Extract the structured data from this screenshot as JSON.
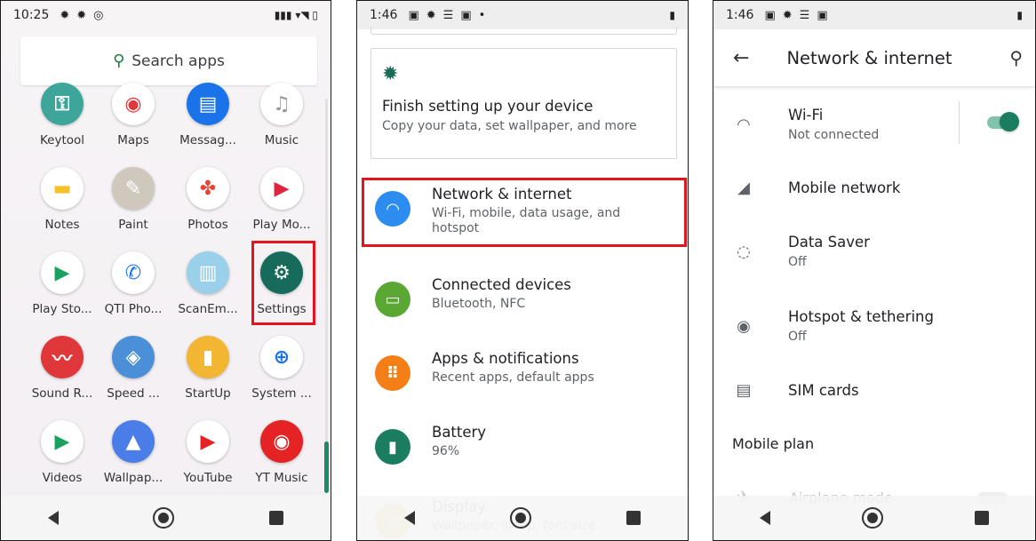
{
  "phone1": {
    "status": {
      "time": "10:25"
    },
    "search": {
      "label": "Search apps"
    },
    "apps": [
      {
        "label": "Keytool",
        "color": "#3da59a",
        "icon": "keytool-icon"
      },
      {
        "label": "Maps",
        "color": "#ffffff",
        "icon": "maps-icon"
      },
      {
        "label": "Messag...",
        "color": "#1a73e8",
        "icon": "messages-icon"
      },
      {
        "label": "Music",
        "color": "#ffffff",
        "icon": "music-icon"
      },
      {
        "label": "Notes",
        "color": "#ffffff",
        "icon": "notes-icon"
      },
      {
        "label": "Paint",
        "color": "#cfc8bd",
        "icon": "paint-icon"
      },
      {
        "label": "Photos",
        "color": "#ffffff",
        "icon": "photos-icon"
      },
      {
        "label": "Play Mo...",
        "color": "#ffffff",
        "icon": "play-movies-icon"
      },
      {
        "label": "Play Sto...",
        "color": "#ffffff",
        "icon": "play-store-icon"
      },
      {
        "label": "QTI Pho...",
        "color": "#ffffff",
        "icon": "phone-icon"
      },
      {
        "label": "ScanEm...",
        "color": "#9bd0ea",
        "icon": "scanem-icon"
      },
      {
        "label": "Settings",
        "color": "#176b5a",
        "icon": "settings-icon"
      },
      {
        "label": "Sound R...",
        "color": "#e0383a",
        "icon": "sound-recorder-icon"
      },
      {
        "label": "Speed ...",
        "color": "#4a8fd8",
        "icon": "speed-icon"
      },
      {
        "label": "StartUp",
        "color": "#f3b632",
        "icon": "startup-icon"
      },
      {
        "label": "System ...",
        "color": "#ffffff",
        "icon": "system-icon"
      },
      {
        "label": "Videos",
        "color": "#ffffff",
        "icon": "videos-icon"
      },
      {
        "label": "Wallpap...",
        "color": "#4b7de8",
        "icon": "wallpaper-icon"
      },
      {
        "label": "YouTube",
        "color": "#ffffff",
        "icon": "youtube-icon"
      },
      {
        "label": "YT Music",
        "color": "#e52224",
        "icon": "yt-music-icon"
      }
    ]
  },
  "phone2": {
    "status": {
      "time": "1:46"
    },
    "card": {
      "title": "Finish setting up your device",
      "subtitle": "Copy your data, set wallpaper, and more"
    },
    "items": [
      {
        "title": "Network & internet",
        "subtitle": "Wi-Fi, mobile, data usage, and hotspot",
        "color": "#2d8cf0",
        "icon": "wifi-icon"
      },
      {
        "title": "Connected devices",
        "subtitle": "Bluetooth, NFC",
        "color": "#5aa733",
        "icon": "connected-devices-icon"
      },
      {
        "title": "Apps & notifications",
        "subtitle": "Recent apps, default apps",
        "color": "#f57f17",
        "icon": "apps-icon"
      },
      {
        "title": "Battery",
        "subtitle": "96%",
        "color": "#1a7d60",
        "icon": "battery-icon"
      },
      {
        "title": "Display",
        "subtitle": "Wallpaper, sleep, font size",
        "color": "#f3b632",
        "icon": "display-icon"
      }
    ]
  },
  "phone3": {
    "status": {
      "time": "1:46"
    },
    "title": "Network & internet",
    "items": [
      {
        "title": "Wi-Fi",
        "subtitle": "Not connected",
        "icon": "wifi-icon"
      },
      {
        "title": "Mobile network",
        "subtitle": "",
        "icon": "signal-icon"
      },
      {
        "title": "Data Saver",
        "subtitle": "Off",
        "icon": "data-saver-icon"
      },
      {
        "title": "Hotspot & tethering",
        "subtitle": "Off",
        "icon": "hotspot-icon"
      },
      {
        "title": "SIM cards",
        "subtitle": "",
        "icon": "sim-card-icon"
      }
    ],
    "section": "Mobile plan",
    "airplane": "Airplane mode",
    "wifi_toggle": true
  }
}
